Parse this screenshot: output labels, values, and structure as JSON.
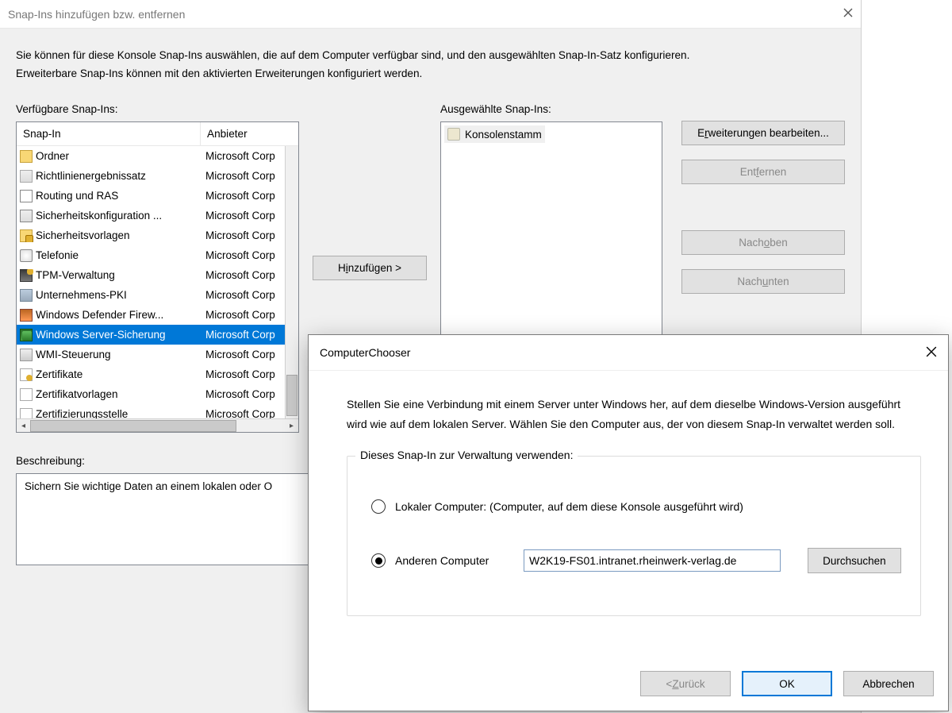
{
  "main": {
    "title": "Snap-Ins hinzufügen bzw. entfernen",
    "intro": "Sie können für diese Konsole Snap-Ins auswählen, die auf dem Computer verfügbar sind, und den ausgewählten Snap-In-Satz konfigurieren. Erweiterbare Snap-Ins können mit den aktivierten Erweiterungen konfiguriert werden.",
    "available_label": "Verfügbare Snap-Ins:",
    "selected_label": "Ausgewählte Snap-Ins:",
    "cols": {
      "snapin": "Snap-In",
      "vendor": "Anbieter"
    },
    "rows": [
      {
        "ico": "f",
        "name": "Ordner",
        "vendor": "Microsoft Corp"
      },
      {
        "ico": "rep",
        "name": "Richtlinienergebnissatz",
        "vendor": "Microsoft Corp"
      },
      {
        "ico": "ras",
        "name": "Routing und RAS",
        "vendor": "Microsoft Corp"
      },
      {
        "ico": "sec",
        "name": "Sicherheitskonfiguration ...",
        "vendor": "Microsoft Corp"
      },
      {
        "ico": "sec2",
        "name": "Sicherheitsvorlagen",
        "vendor": "Microsoft Corp"
      },
      {
        "ico": "tel",
        "name": "Telefonie",
        "vendor": "Microsoft Corp"
      },
      {
        "ico": "tpm",
        "name": "TPM-Verwaltung",
        "vendor": "Microsoft Corp"
      },
      {
        "ico": "pki",
        "name": "Unternehmens-PKI",
        "vendor": "Microsoft Corp"
      },
      {
        "ico": "fw",
        "name": "Windows Defender Firew...",
        "vendor": "Microsoft Corp"
      },
      {
        "ico": "wsb",
        "name": "Windows Server-Sicherung",
        "vendor": "Microsoft Corp",
        "selected": true
      },
      {
        "ico": "wmi",
        "name": "WMI-Steuerung",
        "vendor": "Microsoft Corp"
      },
      {
        "ico": "cert",
        "name": "Zertifikate",
        "vendor": "Microsoft Corp"
      },
      {
        "ico": "cv",
        "name": "Zertifikatvorlagen",
        "vendor": "Microsoft Corp"
      },
      {
        "ico": "cv2",
        "name": "Zertifizierungsstelle",
        "vendor": "Microsoft Corp"
      }
    ],
    "add_btn_pre": "H",
    "add_btn_u": "i",
    "add_btn_post": "nzufügen >",
    "root_item": "Konsolenstamm",
    "side": {
      "edit_pre": "E",
      "edit_u": "r",
      "edit_post": "weiterungen bearbeiten...",
      "remove_pre": "Ent",
      "remove_u": "f",
      "remove_post": "ernen",
      "up_pre": "Nach ",
      "up_u": "o",
      "up_post": "ben",
      "down_pre": "Nach ",
      "down_u": "u",
      "down_post": "nten"
    },
    "desc_label": "Beschreibung:",
    "desc_text": "Sichern Sie wichtige Daten an einem lokalen oder O"
  },
  "modal": {
    "title": "ComputerChooser",
    "intro": "Stellen Sie eine Verbindung mit einem Server unter Windows her, auf dem dieselbe Windows-Version ausgeführt wird wie auf dem lokalen Server. Wählen Sie den Computer aus, der von diesem Snap-In verwaltet werden soll.",
    "group_legend": "Dieses Snap-In zur Verwaltung verwenden:",
    "opt_local": "Lokaler Computer: (Computer, auf dem diese Konsole ausgeführt wird)",
    "opt_other": "Anderen Computer",
    "other_value": "W2K19-FS01.intranet.rheinwerk-verlag.de",
    "browse": "Durchsuchen",
    "back_pre": "< ",
    "back_u": "Z",
    "back_post": "urück",
    "ok": "OK",
    "cancel": "Abbrechen"
  }
}
